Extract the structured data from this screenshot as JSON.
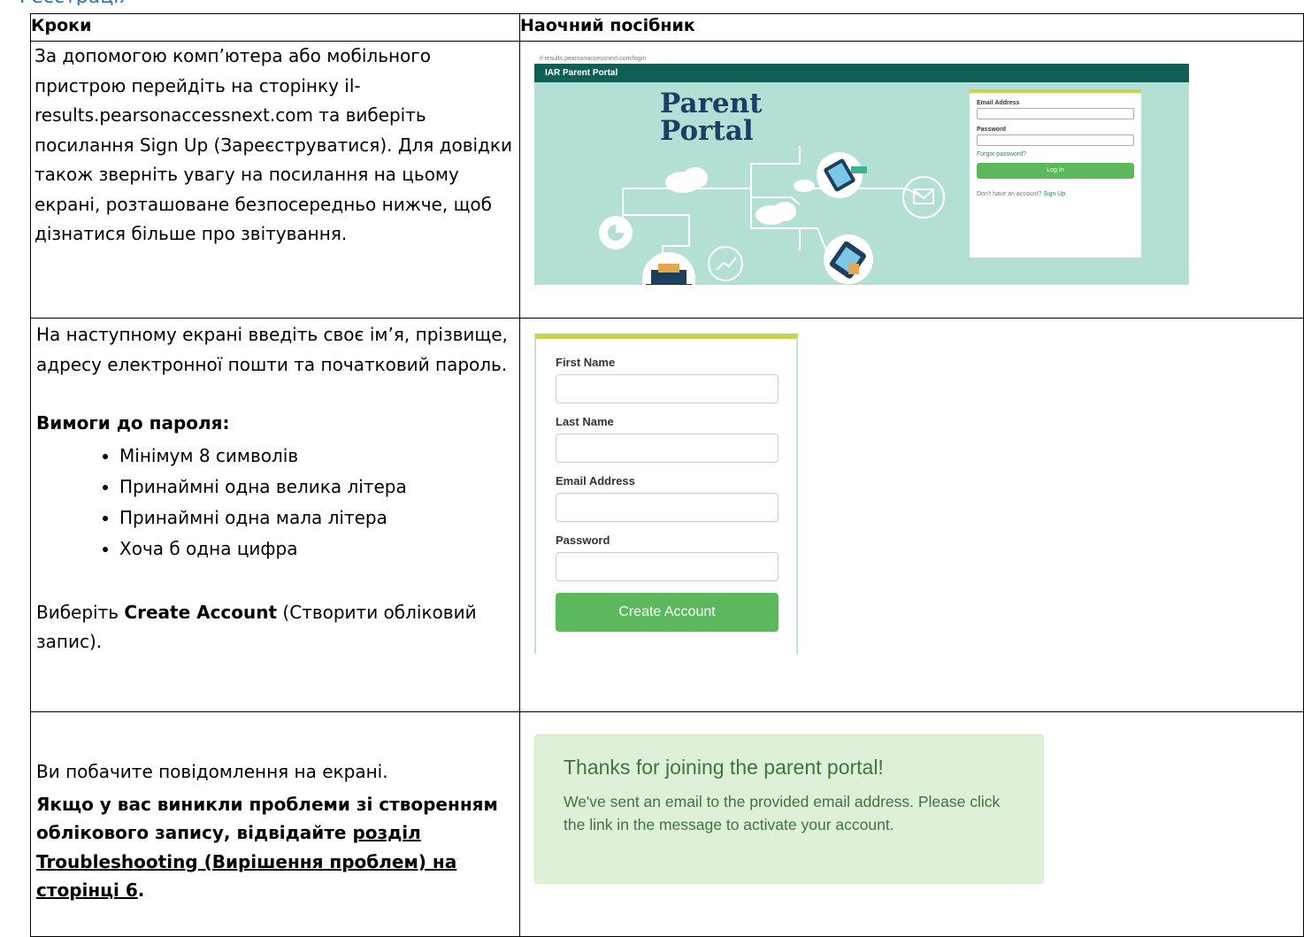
{
  "table": {
    "header_steps": "Кроки",
    "header_guide": "Наочний посібник"
  },
  "row1": {
    "text": "За допомогою комп’ютера або мобільного пристрою перейдіть на сторінку il-results.pearsonaccessnext.com та виберіть посилання Sign Up (Зареєструватися). Для довідки також зверніть увагу на посилання на цьому екрані, розташоване безпосередньо нижче, щоб дізнатися більше про звітування.",
    "portal": {
      "url": "il-results.pearsonaccessnext.com/login",
      "title": "IAR Parent Portal",
      "logo_line1": "Parent",
      "logo_line2": "Portal",
      "email_label": "Email Address",
      "password_label": "Password",
      "forgot": "Forgot password?",
      "login_button": "Log In",
      "no_account": "Don't have an account?",
      "sign_up": "Sign Up",
      "colors": {
        "background": "#b4dfd5",
        "header": "#0f5f57",
        "logo": "#1a3f67",
        "accent": "#c6d646",
        "button": "#5cb85c"
      },
      "icons": [
        "cloud-icon",
        "tablet-icon",
        "phone-icon",
        "email-icon",
        "chart-icon",
        "pie-chart-icon",
        "laptop-icon"
      ]
    }
  },
  "row2": {
    "intro": "На наступному екрані введіть своє ім’я, прізвище, адресу електронної пошти та початковий пароль.",
    "req_title": "Вимоги до пароля:",
    "requirements": [
      "Мінімум 8 символів",
      "Принаймні одна велика літера",
      "Принаймні одна мала літера",
      "Хоча б одна цифра"
    ],
    "select_prefix": "Виберіть ",
    "select_bold": "Create Account",
    "select_suffix": " (Створити обліковий запис).",
    "form": {
      "first_name": "First Name",
      "last_name": "Last Name",
      "email": "Email Address",
      "password": "Password",
      "button": "Create Account"
    }
  },
  "row3": {
    "message": "Ви побачите повідомлення на екрані.",
    "bold_prefix": "Якщо у вас виникли проблеми зі створенням облікового запису, відвідайте ",
    "link_text": "розділ Troubleshooting (Вирішення проблем) на сторінці 6",
    "bold_suffix": ".",
    "alert": {
      "heading": "Thanks for joining the parent portal!",
      "body": "We've sent an email to the provided email address. Please click the link in the message to activate your account."
    }
  }
}
